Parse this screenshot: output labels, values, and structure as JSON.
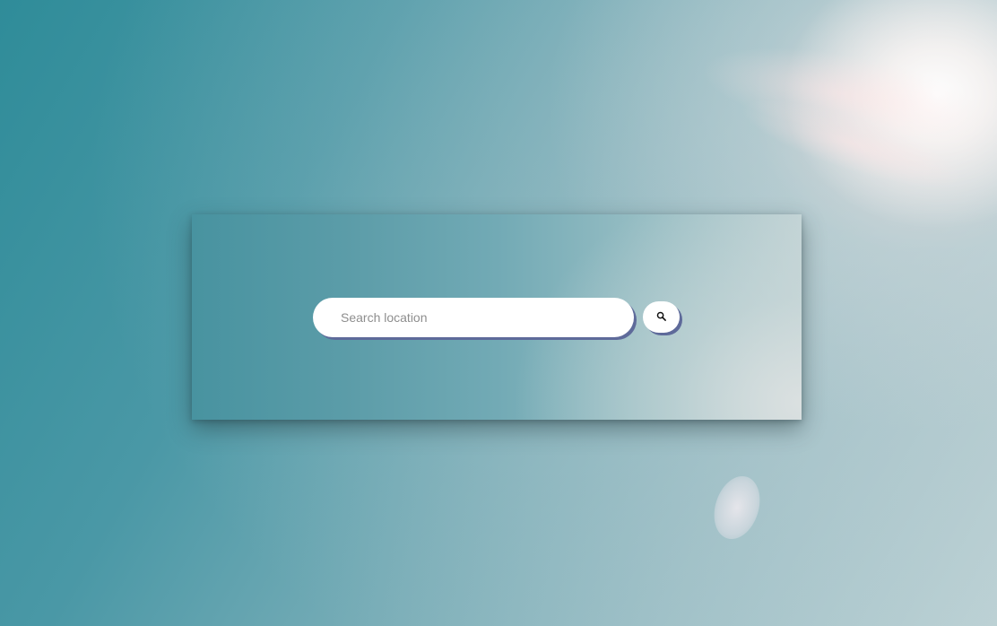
{
  "search": {
    "placeholder": "Search location",
    "value": "",
    "button_icon": "search-icon"
  },
  "colors": {
    "accent_shadow": "#5e6a9a",
    "sky_teal": "#2f8c99"
  }
}
